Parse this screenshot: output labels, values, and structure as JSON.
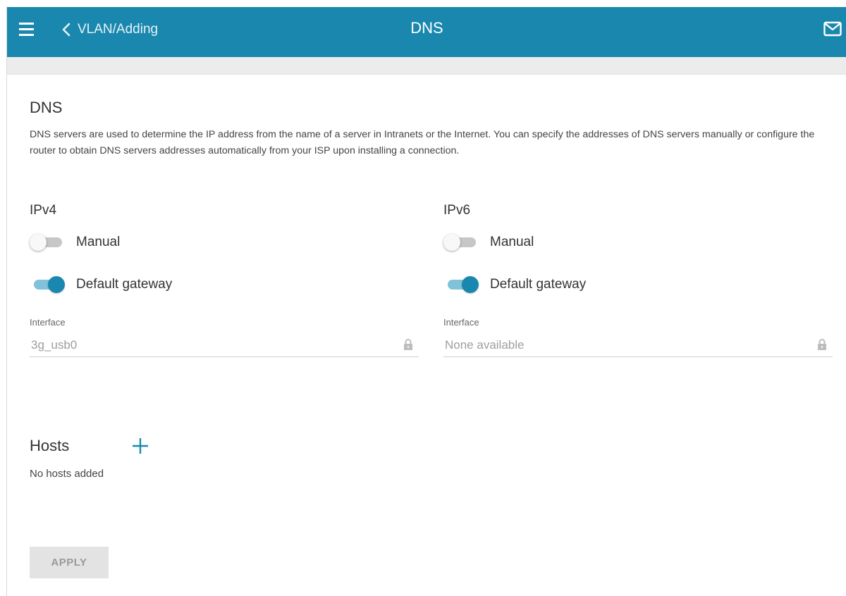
{
  "header": {
    "back_label": "VLAN/Adding",
    "title": "DNS",
    "accent_color": "#1a88ae"
  },
  "section": {
    "title": "DNS",
    "description": "DNS servers are used to determine the IP address from the name of a server in Intranets or the Internet. You can specify the addresses of DNS servers manually or configure the router to obtain DNS servers addresses automatically from your ISP upon installing a connection."
  },
  "ipv4": {
    "title": "IPv4",
    "manual": {
      "label": "Manual",
      "on": false
    },
    "default_gateway": {
      "label": "Default gateway",
      "on": true
    },
    "interface": {
      "label": "Interface",
      "value": "3g_usb0",
      "locked": true
    }
  },
  "ipv6": {
    "title": "IPv6",
    "manual": {
      "label": "Manual",
      "on": false
    },
    "default_gateway": {
      "label": "Default gateway",
      "on": true
    },
    "interface": {
      "label": "Interface",
      "value": "None available",
      "locked": true
    }
  },
  "hosts": {
    "title": "Hosts",
    "empty_text": "No hosts added",
    "add_icon": "plus-icon"
  },
  "actions": {
    "apply_label": "APPLY",
    "apply_enabled": false
  }
}
